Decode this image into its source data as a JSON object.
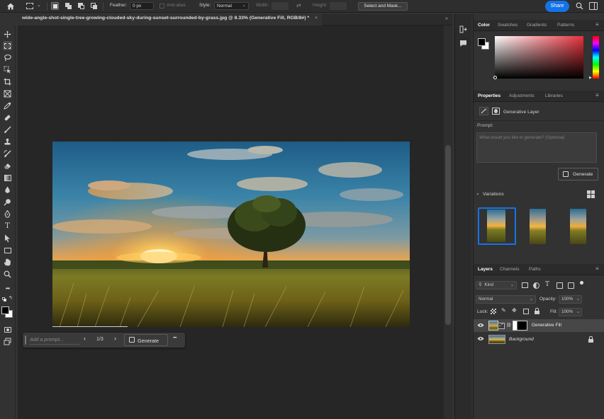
{
  "optionsbar": {
    "feather_label": "Feather:",
    "feather_value": "0 px",
    "antialias_label": "Anti-alias",
    "style_label": "Style:",
    "style_value": "Normal",
    "width_label": "Width:",
    "height_label": "Height:",
    "select_mask_label": "Select and Mask...",
    "share_label": "Share"
  },
  "document": {
    "tab_title": "wide-angle-shot-single-tree-growing-clouded-sky-during-sunset-surrounded-by-grass.jpg @ 8.33% (Generative Fill, RGB/8#) *",
    "close_glyph": "×"
  },
  "contextual_taskbar": {
    "prompt_placeholder": "Add a prompt...",
    "variation_counter": "1/3",
    "generate_label": "Generate",
    "more_glyph": "•••"
  },
  "color_panel": {
    "tabs": [
      "Color",
      "Swatches",
      "Gradients",
      "Patterns"
    ],
    "foreground": "#000000",
    "background": "#ffffff",
    "hue": "#e8323c"
  },
  "properties_panel": {
    "tabs": [
      "Properties",
      "Adjustments",
      "Libraries"
    ],
    "layer_type": "Generative Layer",
    "prompt_label": "Prompt:",
    "prompt_placeholder": "What would you like to generate? (Optional)",
    "generate_label": "Generate",
    "variations_label": "Variations"
  },
  "layers_panel": {
    "tabs": [
      "Layers",
      "Channels",
      "Paths"
    ],
    "filter_kind": "Kind",
    "blend_mode": "Normal",
    "opacity_label": "Opacity:",
    "opacity_value": "100%",
    "lock_label": "Lock:",
    "fill_label": "Fill:",
    "fill_value": "100%",
    "layers": [
      {
        "name": "Generative Fill",
        "visible": true,
        "selected": true
      },
      {
        "name": "Background",
        "visible": true,
        "locked": true
      }
    ]
  },
  "colors": {
    "accent": "#1473e6",
    "app_bg": "#323232",
    "canvas_bg": "#262626"
  }
}
